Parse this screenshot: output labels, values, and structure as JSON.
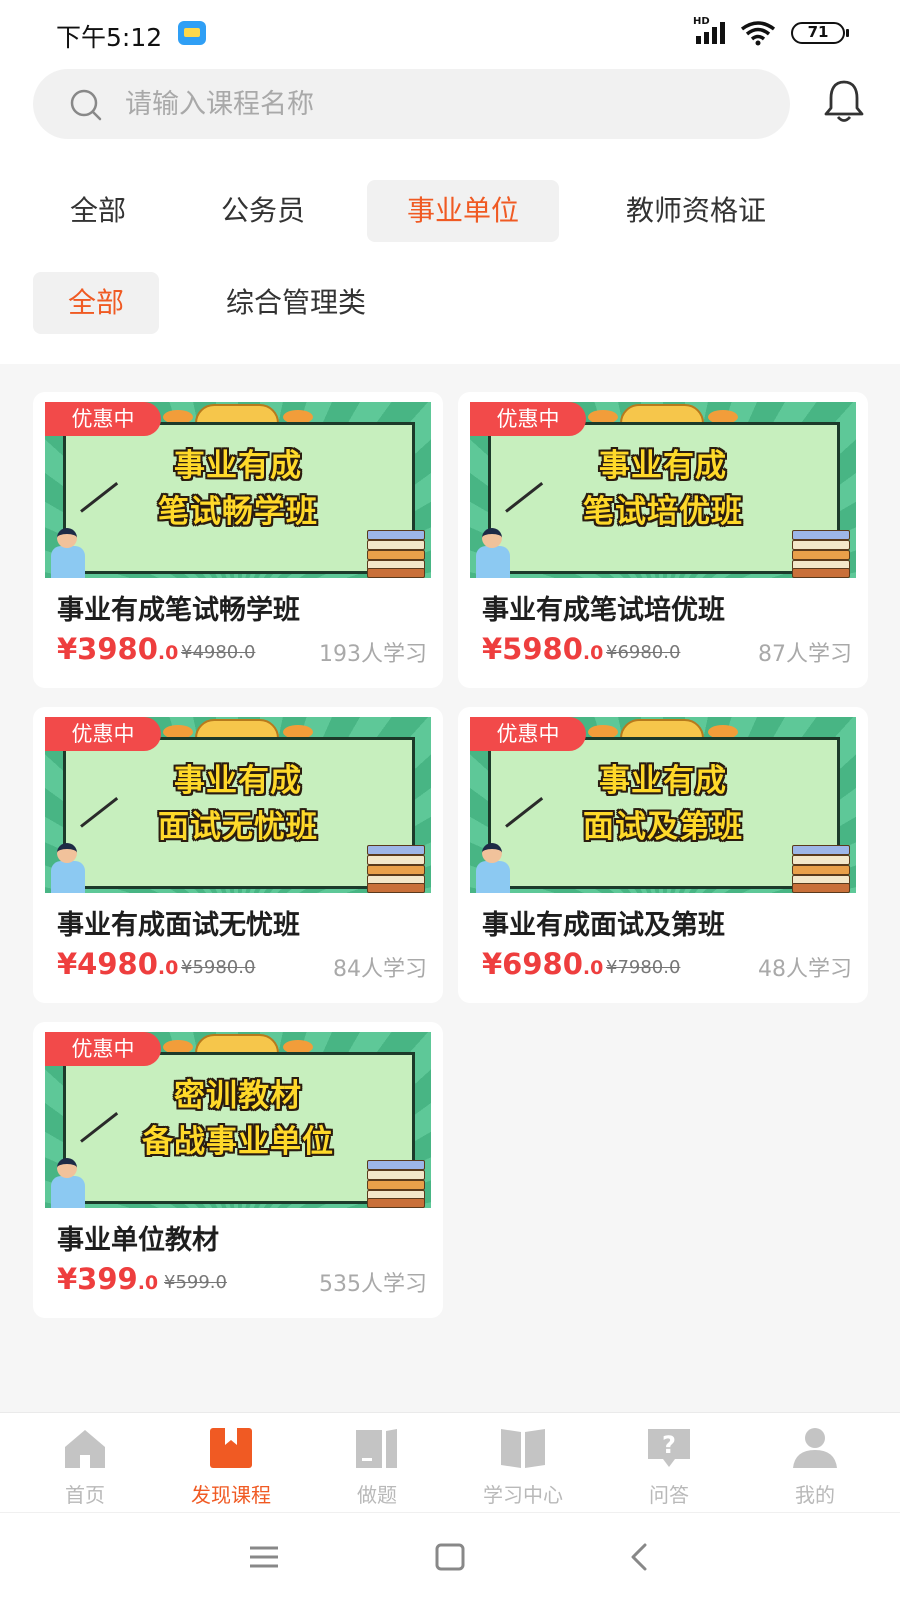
{
  "status_bar": {
    "time": "下午5:12",
    "network": "HD",
    "battery": "71"
  },
  "search": {
    "placeholder": "请输入课程名称"
  },
  "category_tabs": [
    {
      "label": "全部"
    },
    {
      "label": "公务员"
    },
    {
      "label": "事业单位",
      "active": true
    },
    {
      "label": "教师资格证"
    }
  ],
  "sub_tabs": [
    {
      "label": "全部",
      "active": true
    },
    {
      "label": "综合管理类"
    }
  ],
  "courses": [
    {
      "badge": "优惠中",
      "banner_line1": "事业有成",
      "banner_line2": "笔试畅学班",
      "title": "事业有成笔试畅学班",
      "price_int": "¥3980",
      "price_dec": ".0",
      "original_price": "¥4980.0",
      "students": "193人学习"
    },
    {
      "badge": "优惠中",
      "banner_line1": "事业有成",
      "banner_line2": "笔试培优班",
      "title": "事业有成笔试培优班",
      "price_int": "¥5980",
      "price_dec": ".0",
      "original_price": "¥6980.0",
      "students": "87人学习"
    },
    {
      "badge": "优惠中",
      "banner_line1": "事业有成",
      "banner_line2": "面试无忧班",
      "title": "事业有成面试无忧班",
      "price_int": "¥4980",
      "price_dec": ".0",
      "original_price": "¥5980.0",
      "students": "84人学习"
    },
    {
      "badge": "优惠中",
      "banner_line1": "事业有成",
      "banner_line2": "面试及第班",
      "title": "事业有成面试及第班",
      "price_int": "¥6980",
      "price_dec": ".0",
      "original_price": "¥7980.0",
      "students": "48人学习"
    },
    {
      "badge": "优惠中",
      "banner_line1": "密训教材",
      "banner_line2": "备战事业单位",
      "title": "事业单位教材",
      "price_int": "¥399",
      "price_dec": ".0",
      "original_price": "¥599.0",
      "students": "535人学习"
    }
  ],
  "bottom_nav": [
    {
      "label": "首页",
      "icon": "home-icon"
    },
    {
      "label": "发现课程",
      "icon": "bookmark-icon",
      "active": true
    },
    {
      "label": "做题",
      "icon": "exercise-book-icon"
    },
    {
      "label": "学习中心",
      "icon": "open-book-icon"
    },
    {
      "label": "问答",
      "icon": "question-icon"
    },
    {
      "label": "我的",
      "icon": "user-icon"
    }
  ],
  "colors": {
    "accent": "#f05a23",
    "price": "#ee3e3e",
    "badge": "#f24a4a",
    "inactive": "#b9b9b9"
  }
}
